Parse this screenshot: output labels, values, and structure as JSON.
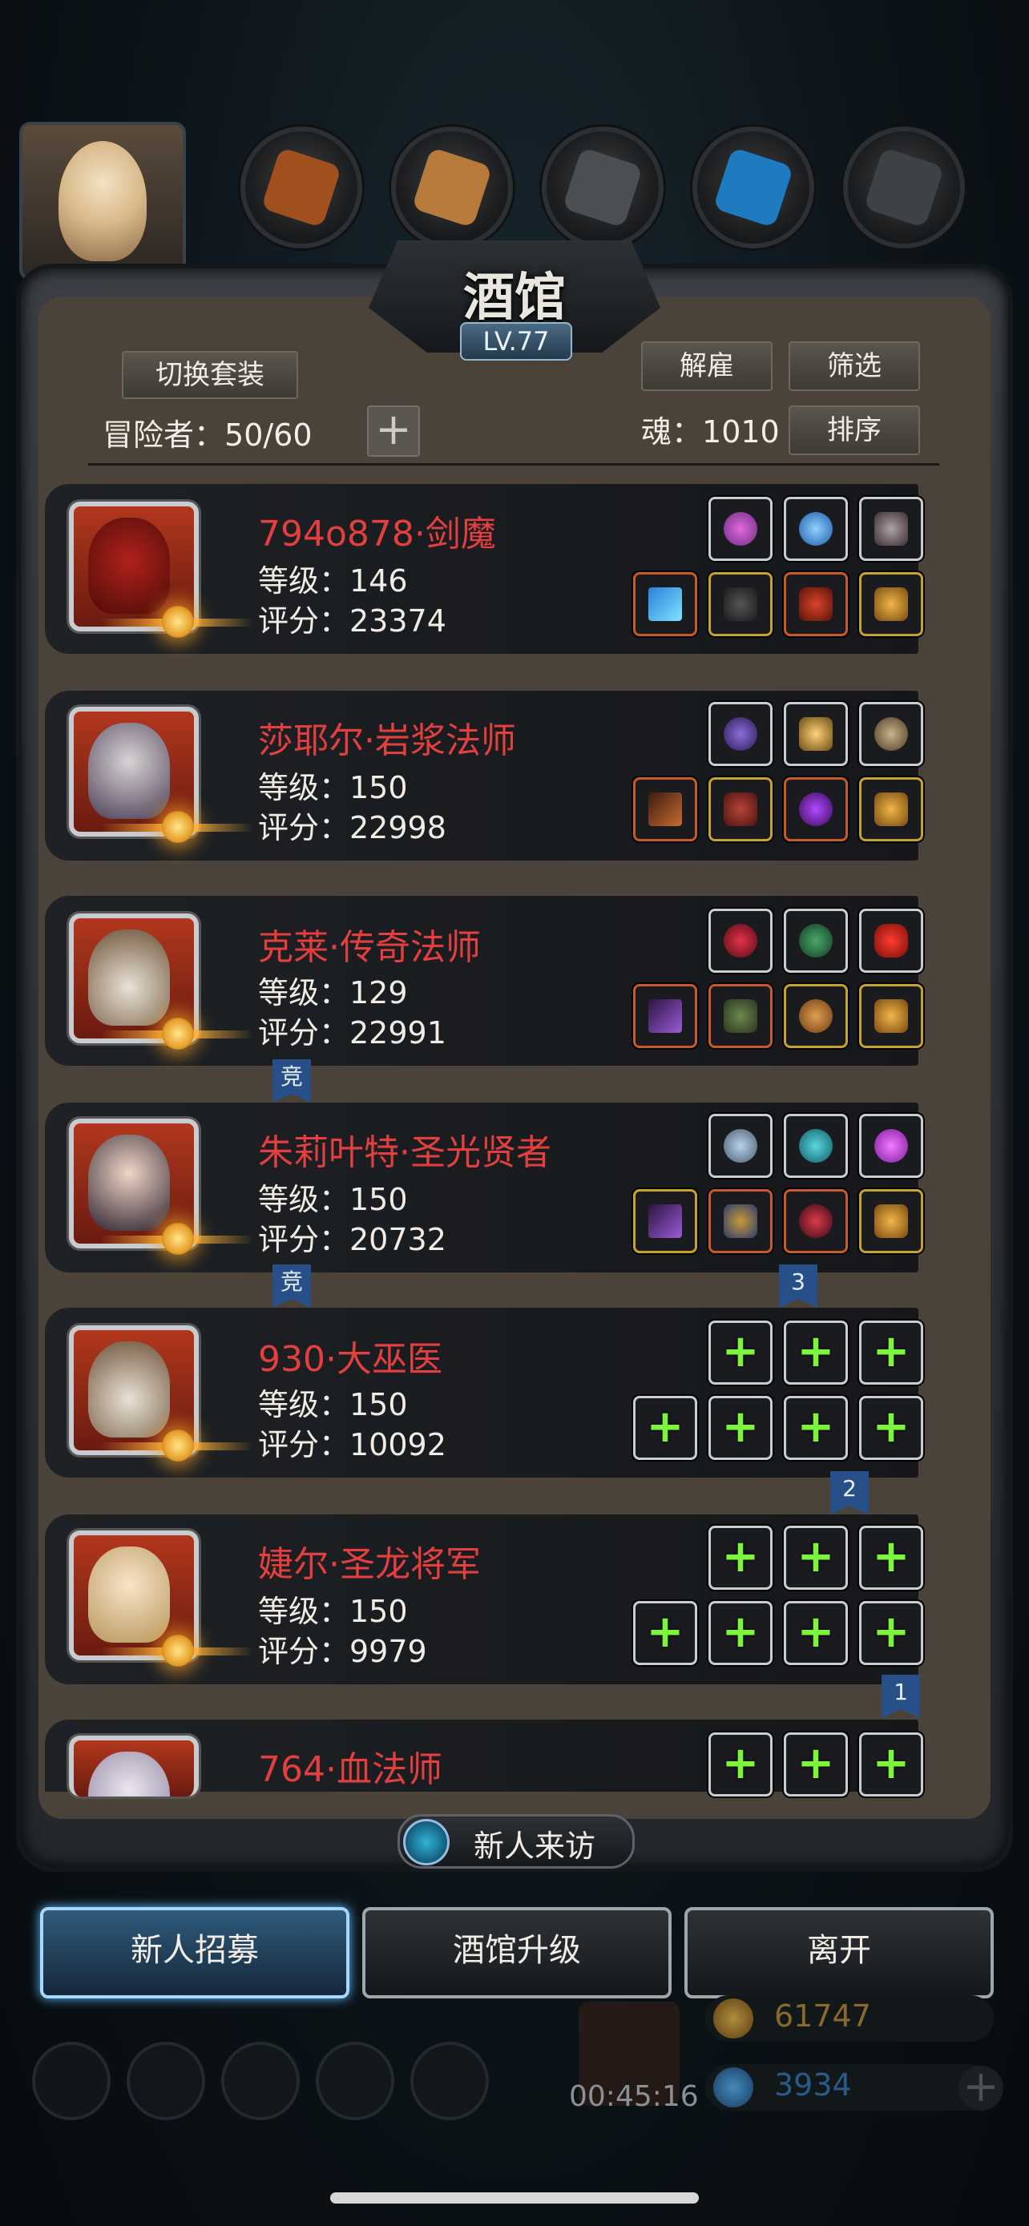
{
  "header": {
    "title": "酒馆",
    "level": "LV.77"
  },
  "toolbar": {
    "switch_set": "切换套装",
    "dismiss": "解雇",
    "filter": "筛选",
    "sort": "排序",
    "adventurers_label": "冒险者：",
    "adventurers_count": "50/60",
    "soul_label": "魂：",
    "soul_value": "1010"
  },
  "adventurers": [
    {
      "name": "794o878·剑魔",
      "level": "等级：146",
      "score": "评分：23374"
    },
    {
      "name": "莎耶尔·岩浆法师",
      "level": "等级：150",
      "score": "评分：22998"
    },
    {
      "name": "克莱·传奇法师",
      "level": "等级：129",
      "score": "评分：22991"
    },
    {
      "name": "朱莉叶特·圣光贤者",
      "level": "等级：150",
      "score": "评分：20732"
    },
    {
      "name": "930·大巫医",
      "level": "等级：150",
      "score": "评分：10092"
    },
    {
      "name": "婕尔·圣龙将军",
      "level": "等级：150",
      "score": "评分：9979"
    },
    {
      "name": "764·血法师",
      "level": "",
      "score": ""
    }
  ],
  "flags": {
    "compete": "竞",
    "three": "3",
    "two": "2",
    "one": "1"
  },
  "visit": {
    "label": "新人来访"
  },
  "bottom": {
    "recruit": "新人招募",
    "upgrade": "酒馆升级",
    "leave": "离开"
  },
  "resources": {
    "timer": "00:45:16",
    "gold": "61747",
    "gems": "3934"
  },
  "colors": {
    "name_red": "#e33f3f",
    "plus_green": "#7cf53b",
    "accent_blue": "#5fbaff"
  }
}
